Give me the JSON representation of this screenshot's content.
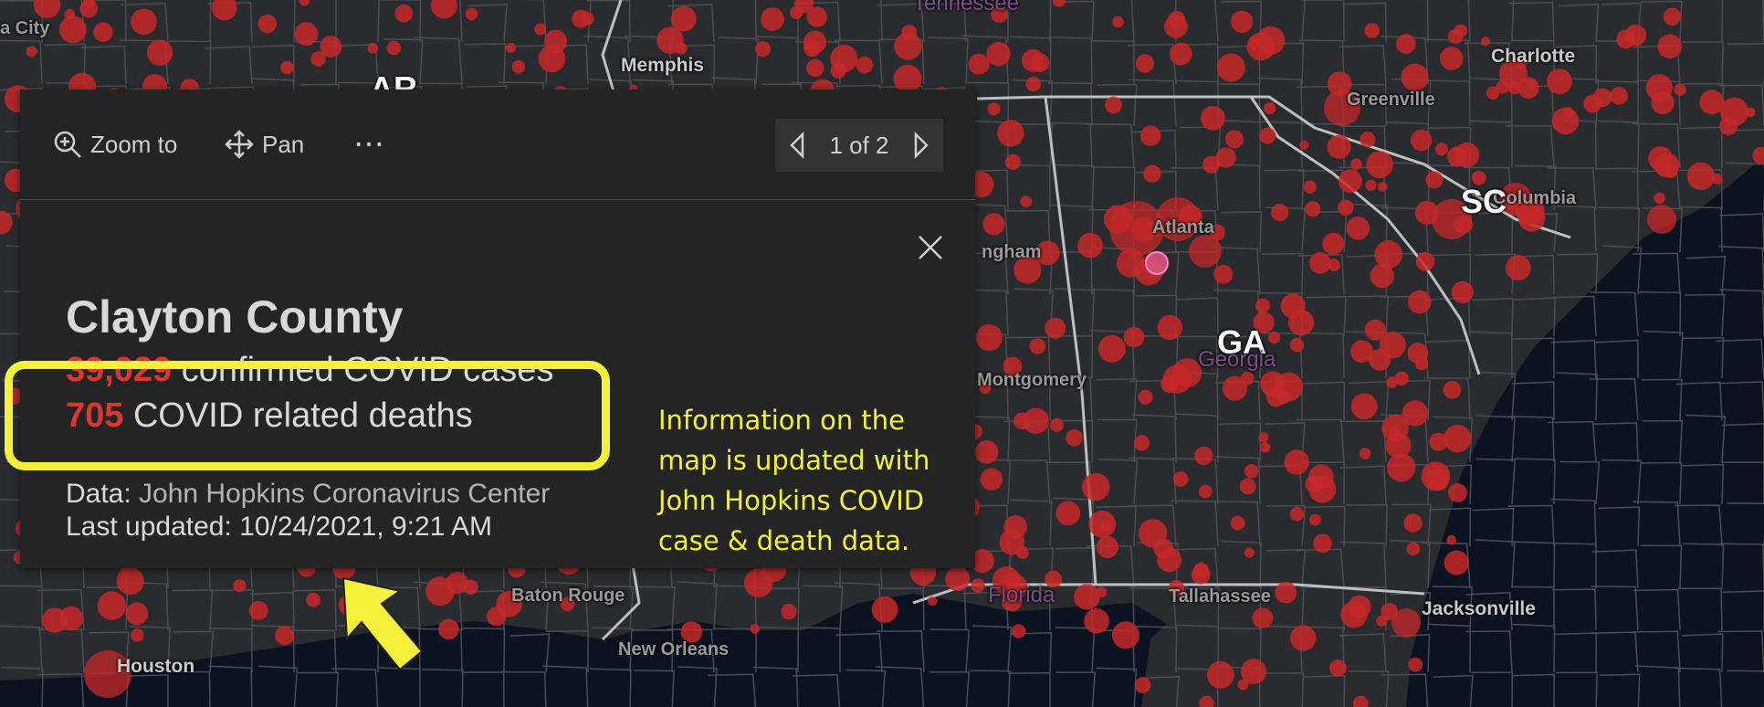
{
  "map": {
    "city_labels": [
      "a City",
      "Memphis",
      "Charlotte",
      "Greenville",
      "Columbia",
      "Atlanta",
      "ngham",
      "Montgomery",
      "Baton Rouge",
      "New Orleans",
      "Houston",
      "Tallahassee",
      "Jacksonville"
    ],
    "state_labels": [
      "AR",
      "SC",
      "GA"
    ],
    "state_names": [
      "Tennessee",
      "Georgia",
      "Florida"
    ],
    "colors": {
      "land": "#2a2b2e",
      "water": "#0b1220",
      "county_border": "#4a4d55",
      "state_border": "#bfbfbf",
      "marker": "#c62828"
    }
  },
  "popup": {
    "toolbar": {
      "zoom_label": "Zoom to",
      "pan_label": "Pan",
      "more_label": "⋯"
    },
    "pager": {
      "text": "1 of 2"
    },
    "title": "Clayton County",
    "cases": {
      "value": "39,029",
      "label": " confirmed COVID cases"
    },
    "deaths": {
      "value": "705",
      "label": " COVID related deaths"
    },
    "source": {
      "prefix": "Data: ",
      "name": "John Hopkins Coronavirus Center"
    },
    "updated": {
      "text": "Last updated: 10/24/2021, 9:21 AM"
    },
    "accent": "#e0342f"
  },
  "annotation": {
    "lines": [
      "Information on the",
      "map is updated with",
      "John Hopkins COVID",
      "case & death data."
    ],
    "color": "#f5f13b"
  }
}
